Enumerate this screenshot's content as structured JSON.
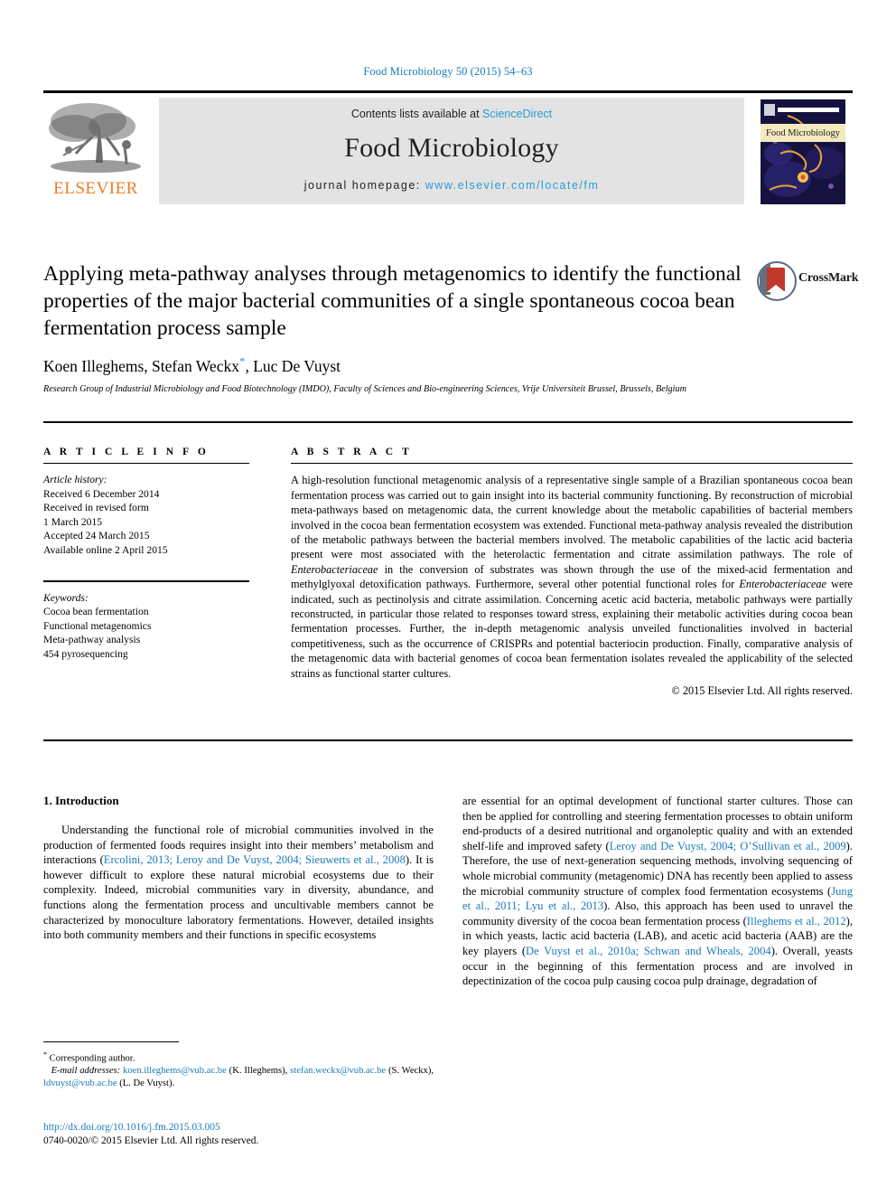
{
  "running_head": "Food Microbiology 50 (2015) 54–63",
  "masthead": {
    "contents_prefix": "Contents lists available at ",
    "sciencedirect": "ScienceDirect",
    "journal_title": "Food Microbiology",
    "homepage_prefix": "journal homepage: ",
    "homepage_url": "www.elsevier.com/locate/fm",
    "publisher_wordmark": "ELSEVIER",
    "cover_title": "Food Microbiology",
    "accent_blue": "#2b9bd6",
    "elsevier_orange": "#ef7d22",
    "band_gray": "#e3e3e3"
  },
  "article": {
    "title": "Applying meta-pathway analyses through metagenomics to identify the functional properties of the major bacterial communities of a single spontaneous cocoa bean fermentation process sample",
    "authors": "Koen Illeghems, Stefan Weckx",
    "author_star": "*",
    "authors_rest": ", Luc De Vuyst",
    "affiliation": "Research Group of Industrial Microbiology and Food Biotechnology (IMDO), Faculty of Sciences and Bio-engineering Sciences, Vrije Universiteit Brussel, Brussels, Belgium",
    "crossmark_label": "CrossMark"
  },
  "info": {
    "heading": "A R T I C L E  I N F O",
    "history_label": "Article history:",
    "history": [
      "Received 6 December 2014",
      "Received in revised form",
      "1 March 2015",
      "Accepted 24 March 2015",
      "Available online 2 April 2015"
    ],
    "keywords_label": "Keywords:",
    "keywords": [
      "Cocoa bean fermentation",
      "Functional metagenomics",
      "Meta-pathway analysis",
      "454 pyrosequencing"
    ]
  },
  "abstract": {
    "heading": "A B S T R A C T",
    "paragraph_1": "A high-resolution functional metagenomic analysis of a representative single sample of a Brazilian spontaneous cocoa bean fermentation process was carried out to gain insight into its bacterial community functioning. By reconstruction of microbial meta-pathways based on metagenomic data, the current knowledge about the metabolic capabilities of bacterial members involved in the cocoa bean fermentation ecosystem was extended. Functional meta-pathway analysis revealed the distribution of the metabolic pathways between the bacterial members involved. The metabolic capabilities of the lactic acid bacteria present were most associated with the heterolactic fermentation and citrate assimilation pathways. The role of ",
    "italic_1": "Enterobacteriaceae",
    "paragraph_2": " in the conversion of substrates was shown through the use of the mixed-acid fermentation and methylglyoxal detoxification pathways. Furthermore, several other potential functional roles for ",
    "italic_2": "Enterobacteriaceae",
    "paragraph_3": " were indicated, such as pectinolysis and citrate assimilation. Concerning acetic acid bacteria, metabolic pathways were partially reconstructed, in particular those related to responses toward stress, explaining their metabolic activities during cocoa bean fermentation processes. Further, the in-depth metagenomic analysis unveiled functionalities involved in bacterial competitiveness, such as the occurrence of CRISPRs and potential bacteriocin production. Finally, comparative analysis of the metagenomic data with bacterial genomes of cocoa bean fermentation isolates revealed the applicability of the selected strains as functional starter cultures.",
    "copyright": "© 2015 Elsevier Ltd. All rights reserved."
  },
  "introduction": {
    "section_number_title": "1. Introduction",
    "left_part_a": "Understanding the functional role of microbial communities involved in the production of fermented foods requires insight into their members’ metabolism and interactions (",
    "left_cite_1": "Ercolini, 2013; Leroy and De Vuyst, 2004; Sieuwerts et al., 2008",
    "left_part_b": "). It is however difficult to explore these natural microbial ecosystems due to their complexity. Indeed, microbial communities vary in diversity, abundance, and functions along the fermentation process and uncultivable members cannot be characterized by monoculture laboratory fermentations. However, detailed insights into both community members and their functions in specific ecosystems",
    "right_part_a": "are essential for an optimal development of functional starter cultures. Those can then be applied for controlling and steering fermentation processes to obtain uniform end-products of a desired nutritional and organoleptic quality and with an extended shelf-life and improved safety (",
    "right_cite_1": "Leroy and De Vuyst, 2004; O’Sullivan et al., 2009",
    "right_part_b": "). Therefore, the use of next-generation sequencing methods, involving sequencing of whole microbial community (metagenomic) DNA has recently been applied to assess the microbial community structure of complex food fermentation ecosystems (",
    "right_cite_2": "Jung et al., 2011; Lyu et al., 2013",
    "right_part_c": "). Also, this approach has been used to unravel the community diversity of the cocoa bean fermentation process (",
    "right_cite_3": "Illeghems et al., 2012",
    "right_part_d": "), in which yeasts, lactic acid bacteria (LAB), and acetic acid bacteria (AAB) are the key players (",
    "right_cite_4": "De Vuyst et al., 2010a; Schwan and Wheals, 2004",
    "right_part_e": "). Overall, yeasts occur in the beginning of this fermentation process and are involved in depectinization of the cocoa pulp causing cocoa pulp drainage, degradation of"
  },
  "footnotes": {
    "corresponding_star": "*",
    "corresponding_text": " Corresponding author.",
    "email_label": "E-mail addresses:",
    "email_1": "koen.illeghems@vub.ac.be",
    "email_1_owner": " (K. Illeghems), ",
    "email_2": "stefan.weckx@vub.ac.be",
    "email_2_owner": " (S. Weckx), ",
    "email_3": "ldvuyst@vub.ac.be",
    "email_3_owner": " (L. De Vuyst).",
    "doi": "http://dx.doi.org/10.1016/j.fm.2015.03.005",
    "issn_line": "0740-0020/© 2015 Elsevier Ltd. All rights reserved."
  }
}
